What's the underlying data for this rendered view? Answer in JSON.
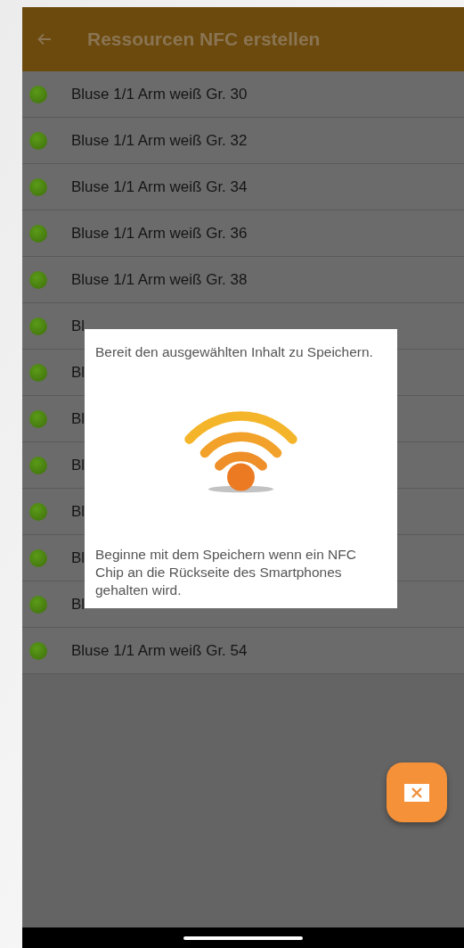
{
  "app_bar": {
    "title": "Ressourcen NFC erstellen"
  },
  "items": [
    {
      "label": "Bluse 1/1 Arm weiß Gr. 30"
    },
    {
      "label": "Bluse 1/1 Arm weiß Gr. 32"
    },
    {
      "label": "Bluse 1/1 Arm weiß Gr. 34"
    },
    {
      "label": "Bluse 1/1 Arm weiß Gr. 36"
    },
    {
      "label": "Bluse 1/1 Arm weiß Gr. 38"
    },
    {
      "label": "Bl"
    },
    {
      "label": "Bl"
    },
    {
      "label": "Bl"
    },
    {
      "label": "Bl"
    },
    {
      "label": "Bl"
    },
    {
      "label": "Bl"
    },
    {
      "label": "Bl"
    },
    {
      "label": "Bluse 1/1 Arm weiß Gr. 54"
    }
  ],
  "dialog": {
    "message": "Bereit den ausgewählten Inhalt zu Speichern.",
    "hint": "Beginne mit dem Speichern wenn ein NFC Chip an die Rückseite des Smartphones gehalten wird."
  }
}
